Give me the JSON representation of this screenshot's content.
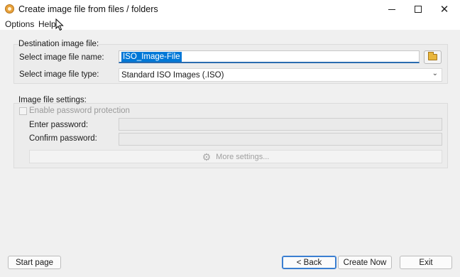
{
  "window": {
    "title": "Create image file from files / folders"
  },
  "menu": {
    "items": [
      "Options",
      "Help"
    ]
  },
  "destination": {
    "group_title": "Destination image file:",
    "name_label": "Select image file name:",
    "name_value": "ISO_Image-File",
    "type_label": "Select image file type:",
    "type_value": "Standard ISO Images (.ISO)"
  },
  "settings": {
    "group_title": "Image file settings:",
    "enable_password_label": "Enable password protection",
    "enter_password_label": "Enter password:",
    "confirm_password_label": "Confirm password:",
    "more_settings_label": "More settings..."
  },
  "footer": {
    "start_page": "Start page",
    "back": "< Back",
    "create_now": "Create Now",
    "exit": "Exit"
  },
  "icons": {
    "app": "app-disc-icon",
    "browse": "folder-icon",
    "more_settings": "gear-icon",
    "dropdown": "chevron-down-icon"
  }
}
